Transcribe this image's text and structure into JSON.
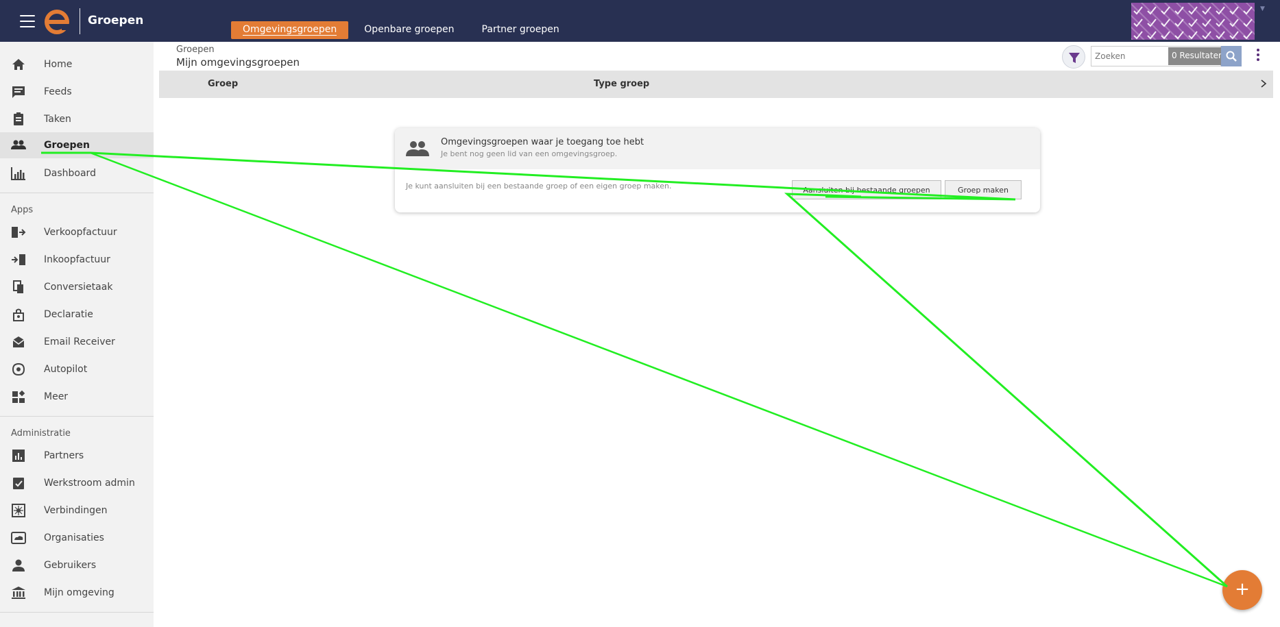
{
  "header": {
    "app_title": "Groepen",
    "tabs": [
      {
        "label": "Omgevingsgroepen",
        "active": true
      },
      {
        "label": "Openbare groepen",
        "active": false
      },
      {
        "label": "Partner groepen",
        "active": false
      }
    ],
    "brand_color": "#283052",
    "accent_color": "#e37c35",
    "avatar_color": "#8e4fa5"
  },
  "sidebar": {
    "main_items": [
      {
        "label": "Home",
        "icon": "home-icon"
      },
      {
        "label": "Feeds",
        "icon": "feeds-icon"
      },
      {
        "label": "Taken",
        "icon": "clipboard-icon"
      },
      {
        "label": "Groepen",
        "icon": "people-icon",
        "active": true
      },
      {
        "label": "Dashboard",
        "icon": "chart-icon"
      }
    ],
    "apps_title": "Apps",
    "apps": [
      {
        "label": "Verkoopfactuur",
        "icon": "invoice-out-icon"
      },
      {
        "label": "Inkoopfactuur",
        "icon": "invoice-in-icon"
      },
      {
        "label": "Conversietaak",
        "icon": "conversion-icon"
      },
      {
        "label": "Declaratie",
        "icon": "expense-icon"
      },
      {
        "label": "Email Receiver",
        "icon": "email-icon"
      },
      {
        "label": "Autopilot",
        "icon": "autopilot-icon"
      },
      {
        "label": "Meer",
        "icon": "more-apps-icon"
      }
    ],
    "admin_title": "Administratie",
    "admin": [
      {
        "label": "Partners",
        "icon": "partners-icon"
      },
      {
        "label": "Werkstroom admin",
        "icon": "workflow-icon"
      },
      {
        "label": "Verbindingen",
        "icon": "connections-icon"
      },
      {
        "label": "Organisaties",
        "icon": "organizations-icon"
      },
      {
        "label": "Gebruikers",
        "icon": "user-icon"
      },
      {
        "label": "Mijn omgeving",
        "icon": "building-icon"
      }
    ]
  },
  "main": {
    "breadcrumb": "Groepen",
    "title": "Mijn omgevingsgroepen",
    "search_placeholder": "Zoeken",
    "results_label": "0 Resultaten",
    "columns": [
      "Groep",
      "Type groep"
    ],
    "panel": {
      "title": "Omgevingsgroepen waar je toegang toe hebt",
      "subtitle": "Je bent nog geen lid van een omgevingsgroep.",
      "body": "Je kunt aansluiten bij een bestaande groep of een eigen groep maken.",
      "join_label": "Aansluiten bij bestaande groepen",
      "create_label": "Groep maken"
    },
    "fab_label": "+"
  }
}
